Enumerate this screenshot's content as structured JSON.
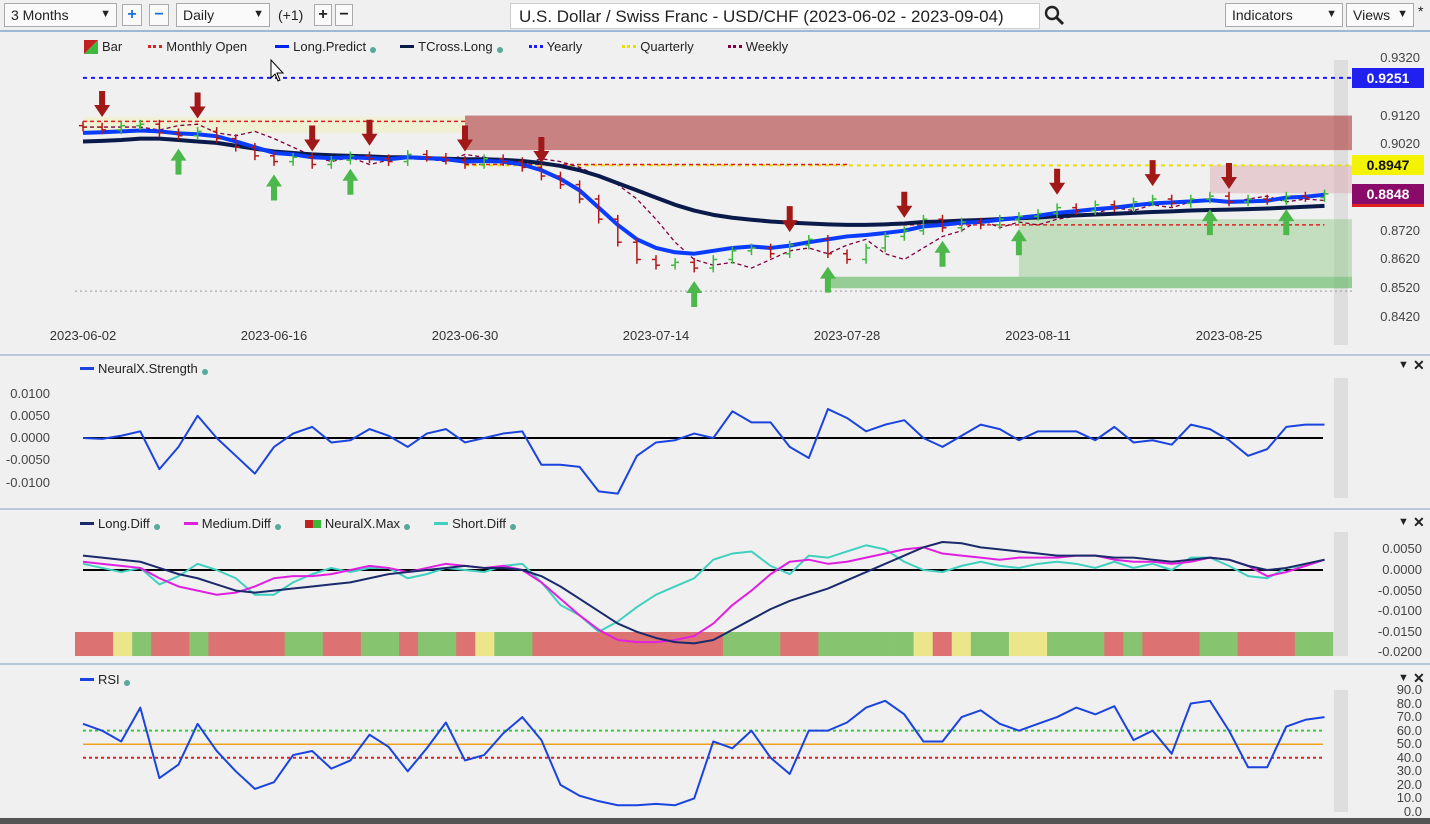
{
  "toolbar": {
    "range": "3 Months",
    "interval": "Daily",
    "offset": "(+1)",
    "title": "U.S. Dollar / Swiss Franc - USD/CHF (2023-06-02 - 2023-09-04)",
    "indicators": "Indicators",
    "views": "Views",
    "plus": "+",
    "minus": "−",
    "star": "*"
  },
  "icons": {
    "search": "search-icon",
    "dropdown": "chevron-down-icon",
    "close": "close-icon"
  },
  "colors": {
    "up": "#3cb83c",
    "down": "#b01818",
    "long_predict": "#0022ee",
    "tcross": "#0a1a4a",
    "yearly": "#1a1aff",
    "quarterly": "#e8e000",
    "monthly": "#e02020",
    "weekly": "#800040",
    "long_diff": "#1a2a6a",
    "medium_diff": "#e020e0",
    "short_diff": "#40d0c0",
    "rsi": "#1a44dd"
  },
  "chart_data": [
    {
      "type": "candlestick",
      "title": "U.S. Dollar / Swiss Franc - USD/CHF (2023-06-02 - 2023-09-04)",
      "legend": [
        "Bar",
        "Monthly Open",
        "Long.Predict",
        "TCross.Long",
        "Yearly",
        "Quarterly",
        "Weekly"
      ],
      "x_ticks": [
        "2023-06-02",
        "2023-06-16",
        "2023-06-30",
        "2023-07-14",
        "2023-07-28",
        "2023-08-11",
        "2023-08-25"
      ],
      "y_ticks": [
        "0.9320",
        "0.9120",
        "0.9020",
        "0.8720",
        "0.8620",
        "0.8520",
        "0.8420"
      ],
      "ylim": [
        0.842,
        0.932
      ],
      "badges": {
        "yearly": "0.9251",
        "quarterly": "0.8947",
        "last": "0.8848"
      },
      "close": [
        0.908,
        0.907,
        0.9085,
        0.909,
        0.906,
        0.905,
        0.9065,
        0.904,
        0.901,
        0.898,
        0.896,
        0.8975,
        0.895,
        0.8965,
        0.898,
        0.897,
        0.896,
        0.8985,
        0.8975,
        0.8965,
        0.895,
        0.897,
        0.896,
        0.894,
        0.891,
        0.888,
        0.883,
        0.876,
        0.868,
        0.862,
        0.86,
        0.861,
        0.859,
        0.862,
        0.865,
        0.866,
        0.864,
        0.867,
        0.869,
        0.864,
        0.862,
        0.866,
        0.87,
        0.872,
        0.876,
        0.873,
        0.875,
        0.874,
        0.876,
        0.877,
        0.878,
        0.88,
        0.879,
        0.881,
        0.88,
        0.882,
        0.883,
        0.8815,
        0.883,
        0.884,
        0.882,
        0.883,
        0.8825,
        0.884,
        0.8835,
        0.8848
      ],
      "long_predict": [
        0.906,
        0.9062,
        0.9065,
        0.9068,
        0.9065,
        0.9058,
        0.9055,
        0.9048,
        0.903,
        0.901,
        0.899,
        0.8985,
        0.8975,
        0.8972,
        0.8975,
        0.8972,
        0.8968,
        0.8975,
        0.8972,
        0.8968,
        0.896,
        0.8962,
        0.896,
        0.895,
        0.893,
        0.89,
        0.886,
        0.88,
        0.874,
        0.869,
        0.866,
        0.8645,
        0.864,
        0.865,
        0.866,
        0.8665,
        0.866,
        0.8668,
        0.868,
        0.869,
        0.87,
        0.8705,
        0.8712,
        0.872,
        0.8735,
        0.874,
        0.8748,
        0.875,
        0.8758,
        0.8765,
        0.8772,
        0.8782,
        0.8788,
        0.8795,
        0.88,
        0.8808,
        0.8815,
        0.8818,
        0.8822,
        0.8826,
        0.882,
        0.8822,
        0.8824,
        0.8835,
        0.8838,
        0.8845
      ],
      "tcross_long": [
        0.903,
        0.9032,
        0.9035,
        0.904,
        0.904,
        0.9035,
        0.903,
        0.9025,
        0.9015,
        0.9005,
        0.8995,
        0.899,
        0.8985,
        0.8982,
        0.898,
        0.8978,
        0.8975,
        0.8975,
        0.8972,
        0.897,
        0.8968,
        0.8968,
        0.8966,
        0.8962,
        0.8955,
        0.8945,
        0.893,
        0.891,
        0.8885,
        0.886,
        0.8835,
        0.881,
        0.879,
        0.8775,
        0.8765,
        0.8758,
        0.8752,
        0.8748,
        0.8745,
        0.8742,
        0.874,
        0.874,
        0.8742,
        0.8745,
        0.875,
        0.8752,
        0.8755,
        0.8757,
        0.876,
        0.8763,
        0.8766,
        0.877,
        0.8773,
        0.8776,
        0.8779,
        0.8782,
        0.8785,
        0.8787,
        0.879,
        0.8792,
        0.8793,
        0.8795,
        0.8797,
        0.88,
        0.8803,
        0.8806
      ],
      "yearly": 0.9251,
      "quarterly": 0.8947,
      "monthly_open": [
        {
          "from": 0,
          "to": 20,
          "value": 0.91
        },
        {
          "from": 20,
          "to": 40,
          "value": 0.895
        },
        {
          "from": 40,
          "to": 65,
          "value": 0.874
        }
      ],
      "sell_signals": [
        1,
        6,
        12,
        15,
        20,
        24,
        37,
        43,
        51,
        56,
        60
      ],
      "buy_signals": [
        5,
        10,
        14,
        32,
        39,
        45,
        49,
        59,
        63
      ],
      "zones": [
        {
          "from": 20,
          "to": 65,
          "low": 0.9,
          "high": 0.912,
          "kind": "resistance"
        },
        {
          "from": 59,
          "to": 65,
          "low": 0.885,
          "high": 0.8947,
          "kind": "pale"
        },
        {
          "from": 39,
          "to": 65,
          "low": 0.852,
          "high": 0.856,
          "kind": "support"
        },
        {
          "from": 49,
          "to": 65,
          "low": 0.856,
          "high": 0.876,
          "kind": "support-light"
        }
      ]
    },
    {
      "type": "line",
      "legend": [
        "NeuralX.Strength"
      ],
      "y_ticks": [
        "0.0100",
        "0.0050",
        "0.0000",
        "-0.0050",
        "-0.0100"
      ],
      "ylim": [
        -0.012,
        0.012
      ],
      "values": [
        0,
        -0.0002,
        0.0005,
        0.0015,
        -0.007,
        -0.002,
        0.005,
        0,
        -0.004,
        -0.008,
        -0.002,
        0.001,
        0.0025,
        -0.001,
        -0.0005,
        0.002,
        0.0005,
        -0.002,
        0.001,
        0.002,
        -0.001,
        0,
        0.001,
        0.0015,
        -0.006,
        -0.006,
        -0.0065,
        -0.012,
        -0.0125,
        -0.004,
        -0.001,
        -0.0005,
        0.001,
        0,
        0.006,
        0.0035,
        0.0035,
        -0.002,
        -0.0045,
        0.0065,
        0.0045,
        0.0015,
        0.003,
        0.004,
        0,
        -0.002,
        0.0005,
        0.003,
        0.002,
        -0.0005,
        0.0015,
        0.0015,
        0.0015,
        -0.0005,
        0.0025,
        -0.001,
        -0.0005,
        -0.0015,
        0.003,
        0.002,
        -0.0005,
        -0.004,
        -0.0025,
        0.0025,
        0.003,
        0.003
      ]
    },
    {
      "type": "line",
      "legend": [
        "Long.Diff",
        "Medium.Diff",
        "NeuralX.Max",
        "Short.Diff"
      ],
      "y_ticks": [
        "0.0050",
        "0.0000",
        "-0.0050",
        "-0.0100",
        "-0.0150",
        "-0.0200"
      ],
      "ylim": [
        -0.02,
        0.007
      ],
      "series": [
        {
          "name": "Long.Diff",
          "values": [
            0.0035,
            0.003,
            0.0025,
            0.002,
            0.0005,
            -0.001,
            -0.002,
            -0.0035,
            -0.005,
            -0.0055,
            -0.005,
            -0.0045,
            -0.004,
            -0.0035,
            -0.003,
            -0.002,
            -0.001,
            -0.0005,
            0,
            0.0005,
            0.001,
            0.0005,
            0.0005,
            0,
            -0.0015,
            -0.004,
            -0.007,
            -0.01,
            -0.013,
            -0.015,
            -0.0165,
            -0.0175,
            -0.0178,
            -0.017,
            -0.0145,
            -0.012,
            -0.0095,
            -0.0075,
            -0.006,
            -0.0045,
            -0.0025,
            -0.0005,
            0.0015,
            0.0035,
            0.0055,
            0.0068,
            0.0065,
            0.0055,
            0.005,
            0.0045,
            0.004,
            0.0035,
            0.0035,
            0.0035,
            0.003,
            0.003,
            0.0025,
            0.002,
            0.0025,
            0.003,
            0.0025,
            0.001,
            0,
            0.0005,
            0.0015,
            0.0025
          ]
        },
        {
          "name": "Medium.Diff",
          "values": [
            0.002,
            0.0015,
            0.001,
            0.0005,
            -0.002,
            -0.004,
            -0.005,
            -0.006,
            -0.0055,
            -0.004,
            -0.002,
            -0.0015,
            -0.0015,
            -0.001,
            0,
            0.001,
            0.0005,
            -0.0005,
            0.0005,
            0.0015,
            0.001,
            0.0005,
            0.001,
            0,
            -0.003,
            -0.007,
            -0.011,
            -0.0145,
            -0.017,
            -0.0175,
            -0.0175,
            -0.017,
            -0.016,
            -0.013,
            -0.0085,
            -0.005,
            -0.001,
            0.002,
            0.0025,
            0.0015,
            0.002,
            0.003,
            0.004,
            0.005,
            0.0055,
            0.004,
            0.0035,
            0.003,
            0.0025,
            0.003,
            0.003,
            0.003,
            0.0035,
            0.0035,
            0.0025,
            0.002,
            0.002,
            0.0015,
            0.002,
            0.003,
            0.0025,
            0.001,
            -0.0015,
            -0.0005,
            0.001,
            0.0025
          ]
        },
        {
          "name": "Short.Diff",
          "values": [
            0.0015,
            0.0005,
            -0.0005,
            0.0005,
            -0.0035,
            -0.0015,
            0.0015,
            0,
            -0.002,
            -0.006,
            -0.006,
            -0.003,
            -0.001,
            0.0005,
            -0.0005,
            0.0005,
            0.0005,
            -0.002,
            -0.001,
            0.0005,
            0,
            -0.0005,
            0.001,
            0.0015,
            -0.003,
            -0.0085,
            -0.011,
            -0.015,
            -0.0125,
            -0.009,
            -0.006,
            -0.004,
            -0.002,
            0.0025,
            0.004,
            0.0045,
            0.001,
            -0.001,
            0.0035,
            0.003,
            0.0045,
            0.006,
            0.005,
            0.002,
            0,
            -0.0005,
            0.001,
            0.002,
            0.001,
            0.0005,
            0.0015,
            0.002,
            0.0015,
            0.0005,
            0.002,
            0.0005,
            0.0015,
            0,
            0.003,
            0.003,
            0.001,
            -0.0015,
            -0.002,
            0.0005,
            0.001,
            0.0025
          ]
        }
      ],
      "neuralx_max": [
        "r",
        "r",
        "y",
        "g",
        "r",
        "r",
        "g",
        "r",
        "r",
        "r",
        "r",
        "g",
        "g",
        "r",
        "r",
        "g",
        "g",
        "r",
        "g",
        "g",
        "r",
        "y",
        "g",
        "g",
        "r",
        "r",
        "r",
        "r",
        "r",
        "r",
        "r",
        "r",
        "r",
        "r",
        "g",
        "g",
        "g",
        "r",
        "r",
        "g",
        "g",
        "g",
        "g",
        "g",
        "y",
        "r",
        "y",
        "g",
        "g",
        "y",
        "y",
        "g",
        "g",
        "g",
        "r",
        "g",
        "r",
        "r",
        "r",
        "g",
        "g",
        "r",
        "r",
        "r",
        "g",
        "g"
      ],
      "neuralx_max_colors": {
        "r": "#dc7272",
        "y": "#ece68a",
        "g": "#86c470"
      }
    },
    {
      "type": "line",
      "legend": [
        "RSI"
      ],
      "y_ticks": [
        "90.0",
        "80.0",
        "70.0",
        "60.0",
        "50.0",
        "40.0",
        "30.0",
        "20.0",
        "10.0",
        "0.0"
      ],
      "ylim": [
        0,
        90
      ],
      "levels": [
        60,
        50,
        40
      ],
      "values": [
        65,
        60,
        52,
        77,
        25,
        35,
        65,
        45,
        30,
        17,
        22,
        42,
        45,
        32,
        38,
        57,
        48,
        30,
        47,
        66,
        38,
        42,
        58,
        70,
        53,
        20,
        12,
        8,
        5,
        5,
        6,
        5,
        10,
        52,
        47,
        60,
        40,
        28,
        60,
        60,
        66,
        77,
        82,
        72,
        52,
        52,
        70,
        75,
        65,
        60,
        65,
        70,
        77,
        72,
        78,
        53,
        60,
        43,
        80,
        82,
        60,
        33,
        33,
        63,
        68,
        70
      ]
    }
  ]
}
